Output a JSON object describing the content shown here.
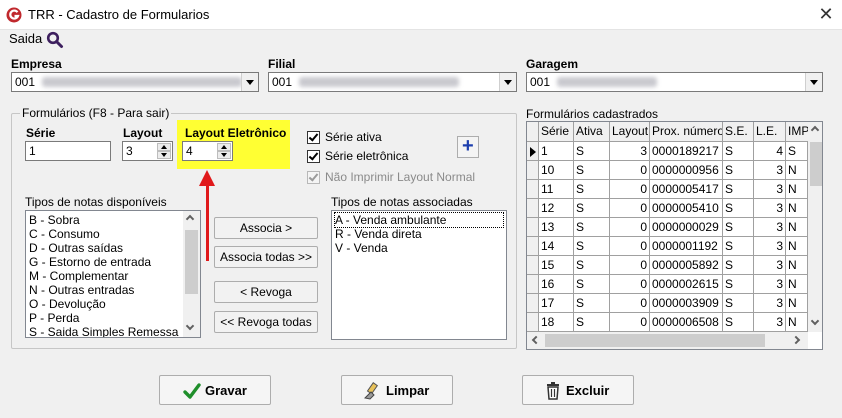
{
  "window": {
    "title": "TRR - Cadastro de Formularios"
  },
  "menu": {
    "saida_label": "Saida"
  },
  "empresa": {
    "label": "Empresa",
    "value": "001"
  },
  "filial": {
    "label": "Filial",
    "value": "001"
  },
  "garagem": {
    "label": "Garagem",
    "value": "001"
  },
  "formularios_group": {
    "title": "Formulários (F8 - Para sair)",
    "serie": {
      "label": "Série",
      "value": "1"
    },
    "layout": {
      "label": "Layout",
      "value": "3"
    },
    "layout_eletronico": {
      "label": "Layout Eletrônico",
      "value": "4"
    },
    "checkboxes": [
      {
        "label": "Série ativa",
        "checked": true,
        "enabled": true
      },
      {
        "label": "Série eletrônica",
        "checked": true,
        "enabled": true
      },
      {
        "label": "Não Imprimir Layout Normal",
        "checked": true,
        "enabled": false
      }
    ],
    "disponiveis": {
      "label": "Tipos de notas disponíveis",
      "items": [
        "B - Sobra",
        "C - Consumo",
        "D - Outras saídas",
        "G - Estorno de entrada",
        "M - Complementar",
        "N - Outras entradas",
        "O - Devolução",
        "P - Perda",
        "S - Saida Simples Remessa"
      ]
    },
    "associadas": {
      "label": "Tipos de notas associadas",
      "items": [
        "A - Venda ambulante",
        "R - Venda direta",
        "V - Venda"
      ]
    },
    "buttons": {
      "associa": "Associa >",
      "associa_todas": "Associa todas >>",
      "revoga": "< Revoga",
      "revoga_todas": "<< Revoga todas"
    }
  },
  "cadastrados": {
    "label": "Formulários cadastrados",
    "columns": [
      "Série",
      "Ativa",
      "Layout",
      "Prox. número",
      "S.E.",
      "L.E.",
      "IMP"
    ],
    "rows": [
      [
        "1",
        "S",
        "3",
        "0000189217",
        "S",
        "4",
        "S"
      ],
      [
        "10",
        "S",
        "0",
        "0000000956",
        "S",
        "3",
        "N"
      ],
      [
        "11",
        "S",
        "0",
        "0000005417",
        "S",
        "3",
        "N"
      ],
      [
        "12",
        "S",
        "0",
        "0000005410",
        "S",
        "3",
        "N"
      ],
      [
        "13",
        "S",
        "0",
        "0000000029",
        "S",
        "3",
        "N"
      ],
      [
        "14",
        "S",
        "0",
        "0000001192",
        "S",
        "3",
        "N"
      ],
      [
        "15",
        "S",
        "0",
        "0000005892",
        "S",
        "3",
        "N"
      ],
      [
        "16",
        "S",
        "0",
        "0000002615",
        "S",
        "3",
        "N"
      ],
      [
        "17",
        "S",
        "0",
        "0000003909",
        "S",
        "3",
        "N"
      ],
      [
        "18",
        "S",
        "0",
        "0000006508",
        "S",
        "3",
        "N"
      ]
    ]
  },
  "actions": {
    "gravar": "Gravar",
    "limpar": "Limpar",
    "excluir": "Excluir"
  },
  "colors": {
    "highlight": "#ffff33",
    "arrow": "#e0191b",
    "plus": "#1e3fae",
    "app_icon": "#c0282d"
  }
}
